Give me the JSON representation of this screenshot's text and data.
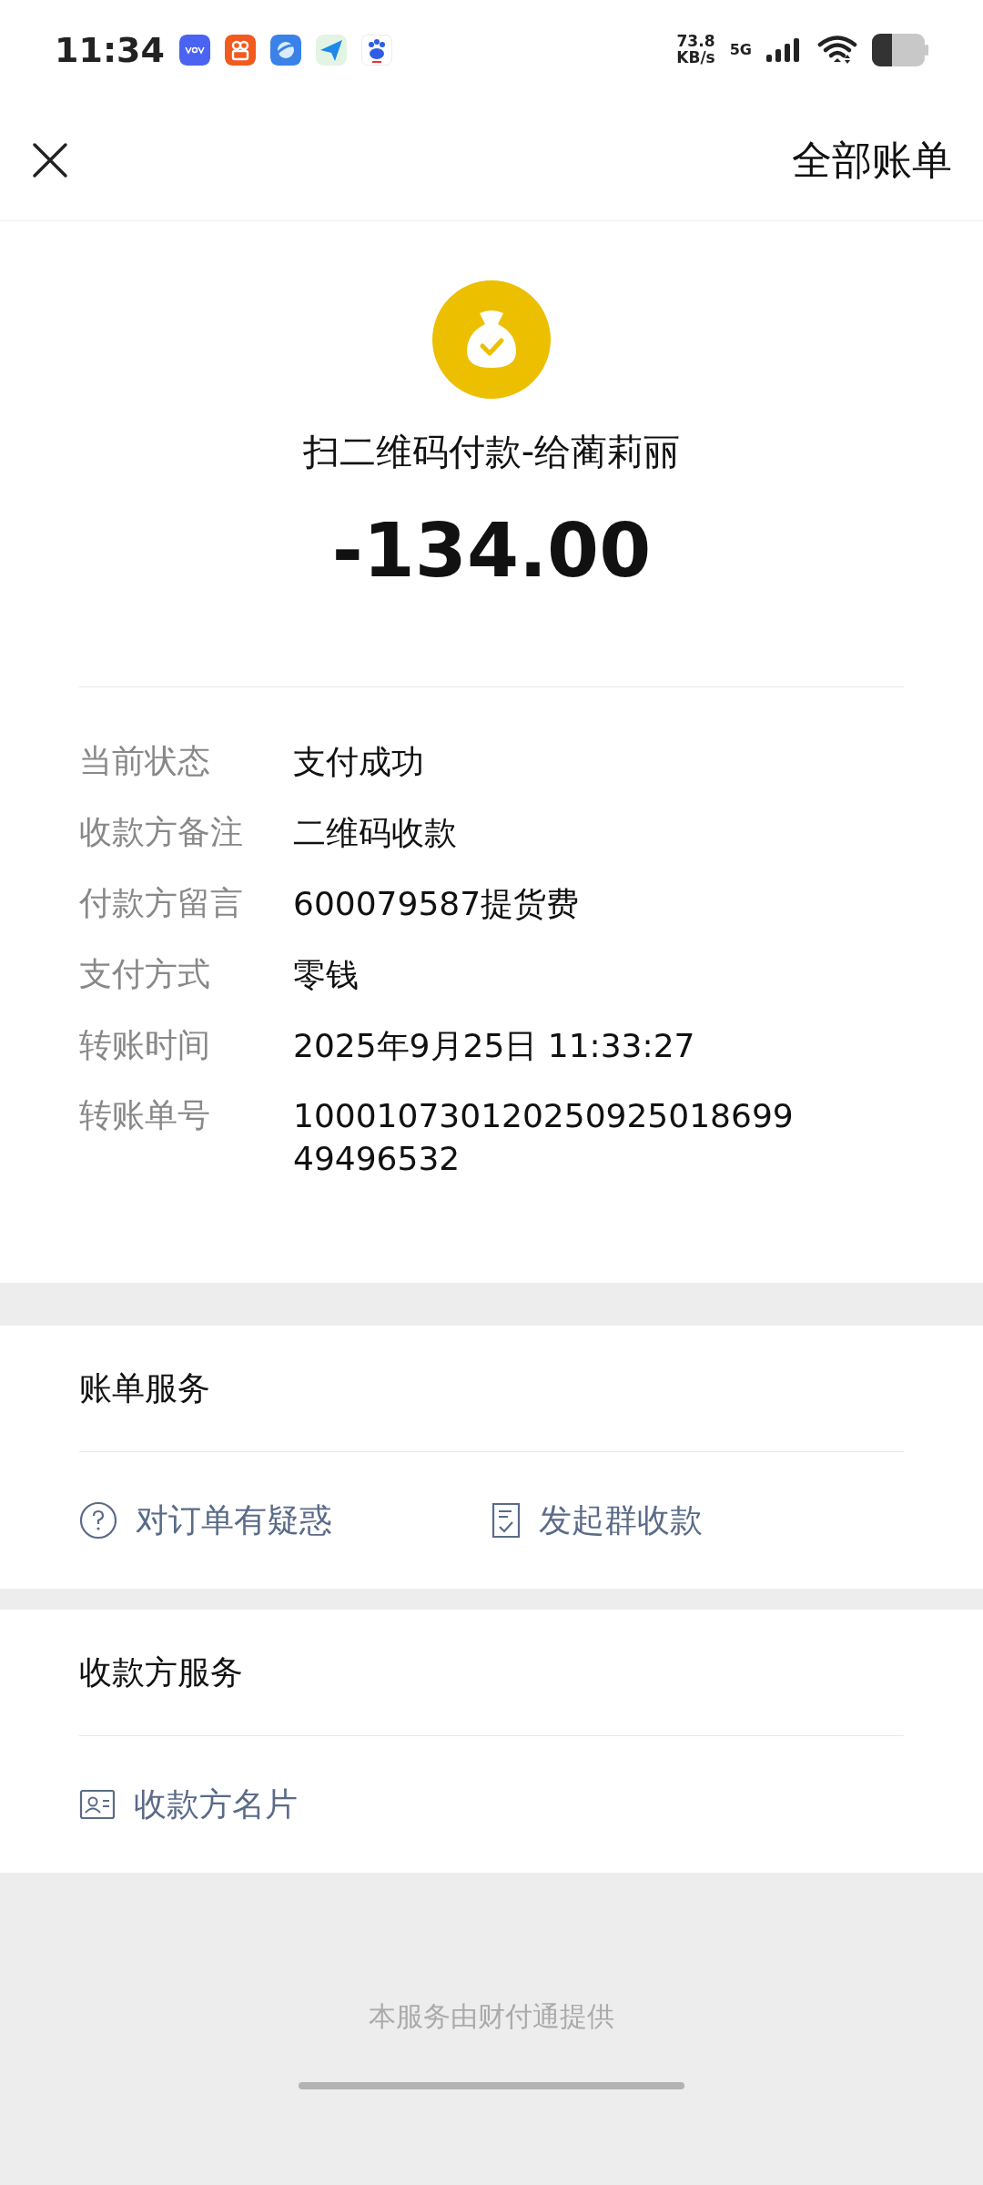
{
  "status_bar": {
    "time": "11:34",
    "network_speed": "73.8",
    "speed_unit": "KB/s",
    "network_type": "5G"
  },
  "header": {
    "title": "全部账单"
  },
  "transaction": {
    "title": "扫二维码付款-给蔺莉丽",
    "amount": "-134.00"
  },
  "details": [
    {
      "label": "当前状态",
      "value": "支付成功"
    },
    {
      "label": "收款方备注",
      "value": "二维码收款"
    },
    {
      "label": "付款方留言",
      "value": "600079587提货费"
    },
    {
      "label": "支付方式",
      "value": "零钱"
    },
    {
      "label": "转账时间",
      "value": "2025年9月25日 11:33:27"
    },
    {
      "label": "转账单号",
      "value": "10001073012025092501869949496532"
    }
  ],
  "sections": [
    {
      "title": "账单服务",
      "actions": [
        {
          "kind": "help",
          "label": "对订单有疑惑"
        },
        {
          "kind": "receipt",
          "label": "发起群收款"
        }
      ]
    },
    {
      "title": "收款方服务",
      "actions": [
        {
          "kind": "card",
          "label": "收款方名片"
        }
      ]
    }
  ],
  "footer": "本服务由财付通提供"
}
